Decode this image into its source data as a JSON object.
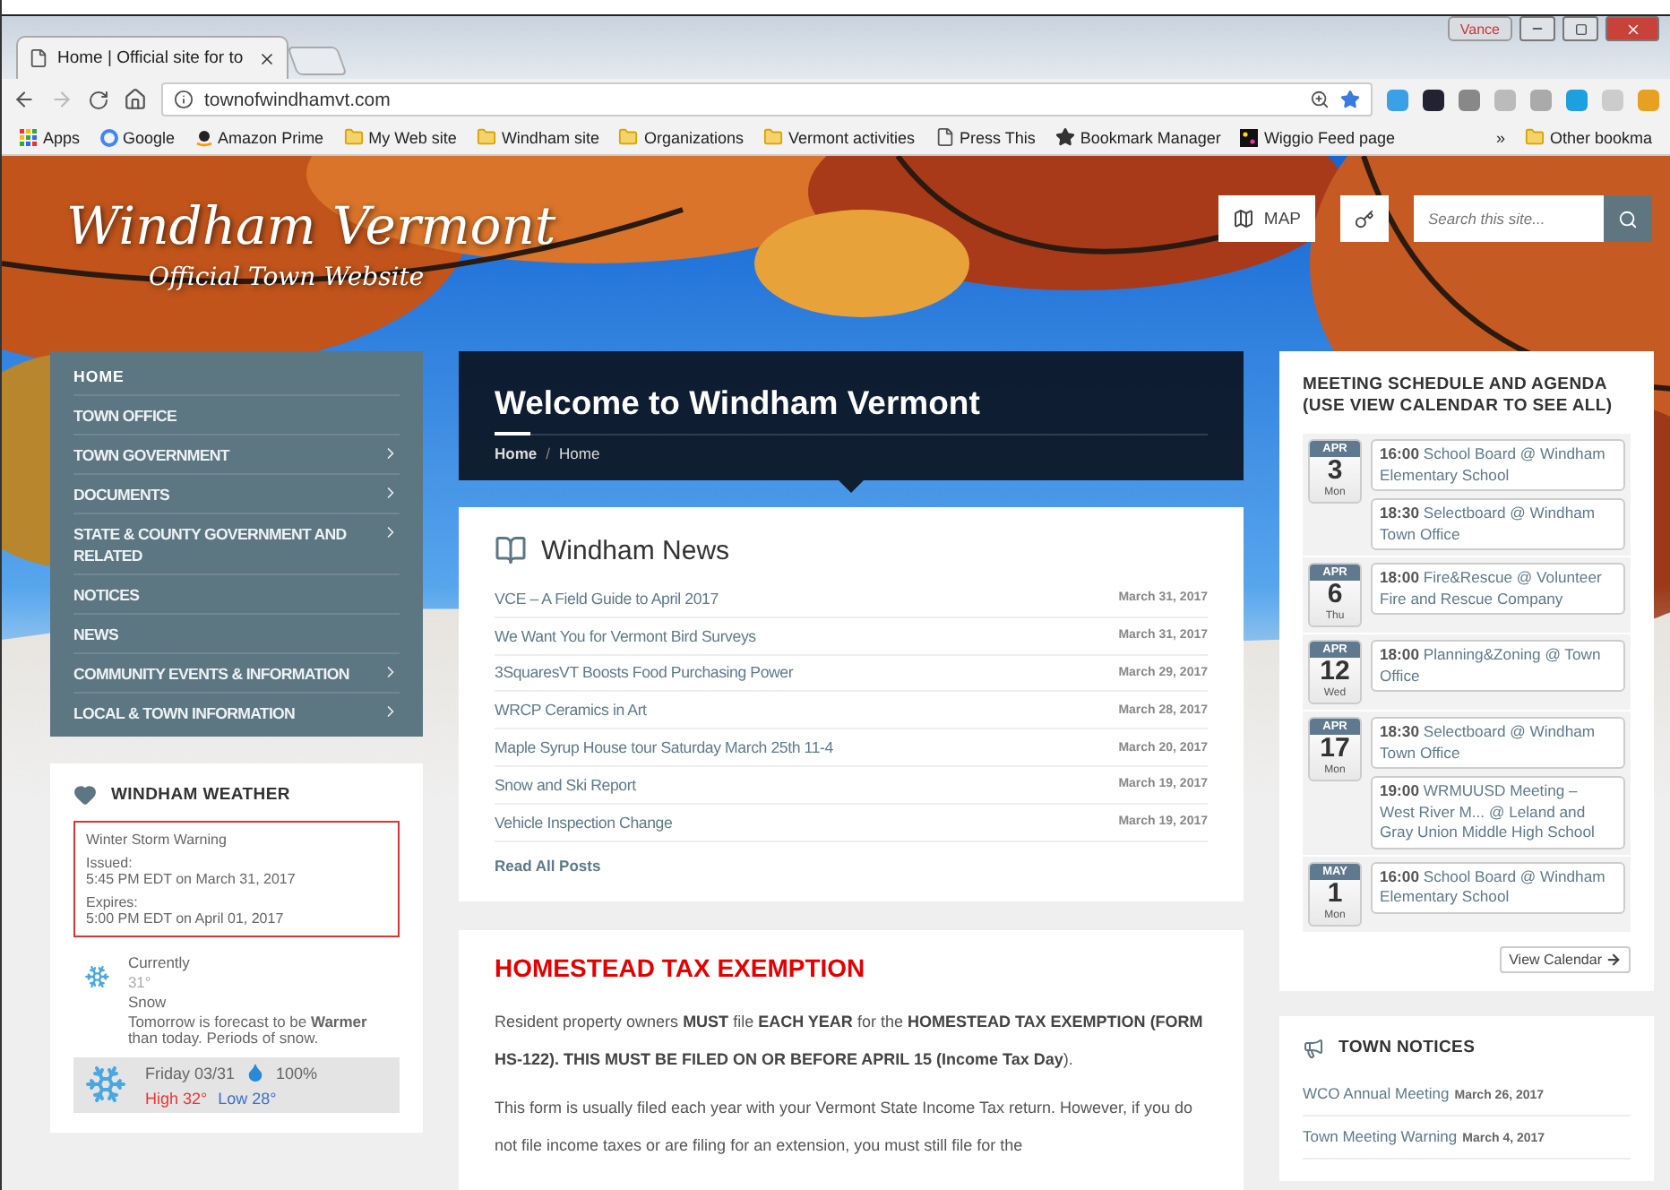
{
  "browser": {
    "tab_title": "Home | Official site for to",
    "profile_name": "Vance",
    "url": "townofwindhamvt.com",
    "bookmarks": [
      {
        "label": "Apps",
        "kind": "apps"
      },
      {
        "label": "Google",
        "kind": "google"
      },
      {
        "label": "Amazon Prime",
        "kind": "amazon"
      },
      {
        "label": "My Web site",
        "kind": "folder"
      },
      {
        "label": "Windham site",
        "kind": "folder"
      },
      {
        "label": "Organizations",
        "kind": "folder"
      },
      {
        "label": "Vermont activities",
        "kind": "folder"
      },
      {
        "label": "Press This",
        "kind": "page"
      },
      {
        "label": "Bookmark Manager",
        "kind": "star"
      },
      {
        "label": "Wiggio Feed page",
        "kind": "wiggio"
      }
    ],
    "overflow": "»",
    "other_bookmarks": "Other bookma"
  },
  "site": {
    "title": "Windham Vermont",
    "subtitle": "Official Town Website",
    "map_button": "MAP",
    "search_placeholder": "Search this site..."
  },
  "nav": {
    "items": [
      {
        "label": "HOME",
        "submenu": false,
        "selected": true
      },
      {
        "label": "TOWN OFFICE",
        "submenu": false,
        "selected": false
      },
      {
        "label": "TOWN GOVERNMENT",
        "submenu": true,
        "selected": false
      },
      {
        "label": "DOCUMENTS",
        "submenu": true,
        "selected": false
      },
      {
        "label": "STATE & COUNTY GOVERNMENT AND RELATED",
        "submenu": true,
        "selected": false
      },
      {
        "label": "NOTICES",
        "submenu": false,
        "selected": false
      },
      {
        "label": "NEWS",
        "submenu": false,
        "selected": false
      },
      {
        "label": "COMMUNITY EVENTS & INFORMATION",
        "submenu": true,
        "selected": false
      },
      {
        "label": "LOCAL & TOWN INFORMATION",
        "submenu": true,
        "selected": false
      }
    ]
  },
  "weather": {
    "title": "WINDHAM WEATHER",
    "alert": {
      "title": "Winter Storm Warning",
      "issued_label": "Issued:",
      "issued": "5:45 PM EDT on March 31, 2017",
      "expires_label": "Expires:",
      "expires": "5:00 PM EDT on April 01, 2017"
    },
    "current": {
      "label": "Currently",
      "temp": "31°",
      "condition": "Snow",
      "forecast": "Tomorrow is forecast to be **Warmer** than today. Periods of snow."
    },
    "day": {
      "label": "Friday 03/31",
      "precip": "100%",
      "high": "High 32°",
      "low": "Low 28°"
    }
  },
  "header": {
    "title": "Welcome to Windham Vermont",
    "breadcrumb": [
      "Home",
      "Home"
    ],
    "separator": "/"
  },
  "news": {
    "title": "Windham News",
    "items": [
      {
        "title": "VCE – A Field Guide to April 2017",
        "date": "March 31, 2017"
      },
      {
        "title": "We Want You for Vermont Bird Surveys",
        "date": "March 31, 2017"
      },
      {
        "title": "3SquaresVT Boosts Food Purchasing Power",
        "date": "March 29, 2017"
      },
      {
        "title": "WRCP Ceramics in Art",
        "date": "March 28, 2017"
      },
      {
        "title": "Maple Syrup House tour Saturday March 25th 11-4",
        "date": "March 20, 2017"
      },
      {
        "title": "Snow and Ski Report",
        "date": "March 19, 2017"
      },
      {
        "title": "Vehicle Inspection Change",
        "date": "March 19, 2017"
      }
    ],
    "read_all": "Read All Posts"
  },
  "homestead": {
    "title": "HOMESTEAD TAX EXEMPTION",
    "paragraphs": [
      "Resident property owners **MUST** file **EACH YEAR** for the **HOMESTEAD TAX EXEMPTION** **(FORM HS-122). THIS MUST BE FILED ON OR BEFORE APRIL 15 (Income Tax Day**).",
      "This form is usually filed each year with your Vermont State Income Tax return. However, if you do not file income taxes or are filing for an extension, you must still file for the"
    ]
  },
  "meetings": {
    "title": "MEETING SCHEDULE AND AGENDA (USE VIEW CALENDAR TO SEE ALL)",
    "days": [
      {
        "month": "APR",
        "day": "3",
        "weekday": "Mon",
        "events": [
          {
            "time": "16:00",
            "text": "School Board @ Windham Elementary School"
          },
          {
            "time": "18:30",
            "text": "Selectboard @ Windham Town Office"
          }
        ]
      },
      {
        "month": "APR",
        "day": "6",
        "weekday": "Thu",
        "events": [
          {
            "time": "18:00",
            "text": "Fire&Rescue @ Volunteer Fire and Rescue Company"
          }
        ]
      },
      {
        "month": "APR",
        "day": "12",
        "weekday": "Wed",
        "events": [
          {
            "time": "18:00",
            "text": "Planning&Zoning @ Town Office"
          }
        ]
      },
      {
        "month": "APR",
        "day": "17",
        "weekday": "Mon",
        "events": [
          {
            "time": "18:30",
            "text": "Selectboard @ Windham Town Office"
          },
          {
            "time": "19:00",
            "text": "WRMUUSD Meeting – West River M... @ Leland and Gray Union Middle High School"
          }
        ]
      },
      {
        "month": "MAY",
        "day": "1",
        "weekday": "Mon",
        "events": [
          {
            "time": "16:00",
            "text": "School Board @ Windham Elementary School"
          }
        ]
      }
    ],
    "view_calendar": "View Calendar"
  },
  "notices": {
    "title": "TOWN NOTICES",
    "items": [
      {
        "title": "WCO Annual Meeting",
        "date": "March 26, 2017"
      },
      {
        "title": "Town Meeting Warning",
        "date": "March 4, 2017"
      }
    ]
  }
}
